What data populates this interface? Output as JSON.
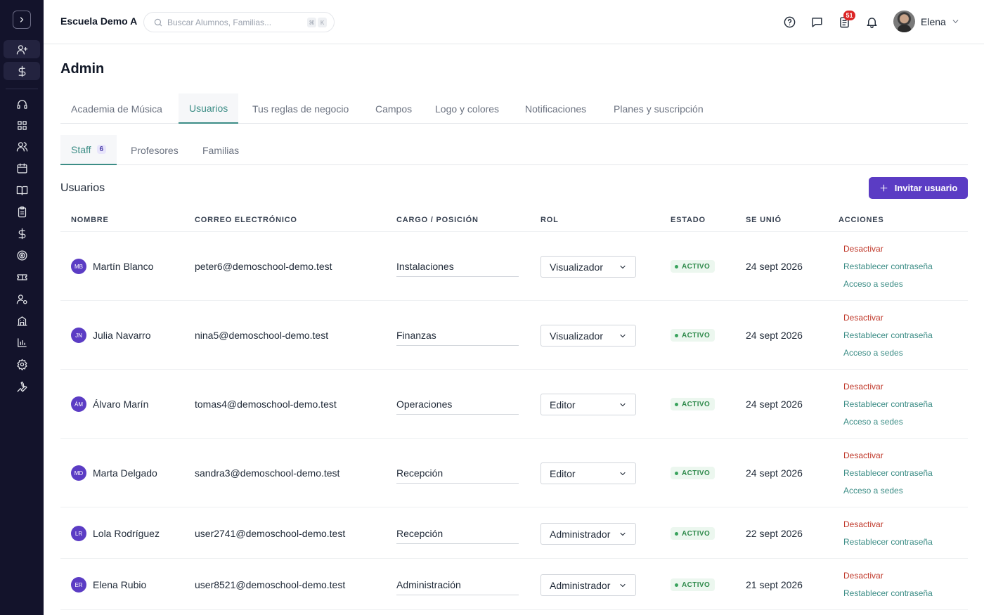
{
  "topbar": {
    "school_name": "Escuela Demo A",
    "search_placeholder": "Buscar Alumnos, Familias...",
    "kbd_1": "⌘",
    "kbd_2": "K",
    "notifications_count": "51",
    "user_name": "Elena"
  },
  "page": {
    "title": "Admin",
    "tabs": [
      "Academia de Música",
      "Usuarios",
      "Tus reglas de negocio",
      "Campos",
      "Logo y colores",
      "Notificaciones",
      "Planes y suscripción"
    ],
    "active_tab": "Usuarios",
    "subtabs": [
      "Staff",
      "Profesores",
      "Familias"
    ],
    "staff_count": "6",
    "section_title": "Usuarios",
    "invite_label": "Invitar usuario"
  },
  "table": {
    "headers": {
      "name": "NOMBRE",
      "email": "CORREO ELECTRÓNICO",
      "position": "CARGO / POSICIÓN",
      "role": "ROL",
      "status": "ESTADO",
      "joined": "SE UNIÓ",
      "actions": "ACCIONES"
    },
    "action_labels": {
      "deactivate": "Desactivar",
      "reset_password": "Restablecer contraseña",
      "site_access": "Acceso a sedes"
    },
    "rows": [
      {
        "initials": "MB",
        "name": "Martín Blanco",
        "email": "peter6@demoschool-demo.test",
        "position": "Instalaciones",
        "role": "Visualizador",
        "status": "ACTIVO",
        "joined": "24 sept 2026"
      },
      {
        "initials": "JN",
        "name": "Julia Navarro",
        "email": "nina5@demoschool-demo.test",
        "position": "Finanzas",
        "role": "Visualizador",
        "status": "ACTIVO",
        "joined": "24 sept 2026"
      },
      {
        "initials": "ÁM",
        "name": "Álvaro Marín",
        "email": "tomas4@demoschool-demo.test",
        "position": "Operaciones",
        "role": "Editor",
        "status": "ACTIVO",
        "joined": "24 sept 2026"
      },
      {
        "initials": "MD",
        "name": "Marta Delgado",
        "email": "sandra3@demoschool-demo.test",
        "position": "Recepción",
        "role": "Editor",
        "status": "ACTIVO",
        "joined": "24 sept 2026"
      },
      {
        "initials": "LR",
        "name": "Lola Rodríguez",
        "email": "user2741@demoschool-demo.test",
        "position": "Recepción",
        "role": "Administrador",
        "status": "ACTIVO",
        "joined": "22 sept 2026"
      },
      {
        "initials": "ER",
        "name": "Elena Rubio",
        "email": "user8521@demoschool-demo.test",
        "position": "Administración",
        "role": "Administrador",
        "status": "ACTIVO",
        "joined": "21 sept 2026"
      }
    ]
  },
  "colors": {
    "sidebar_bg": "#13132b",
    "accent_teal": "#3c8d86",
    "primary_purple": "#5b3cc4",
    "danger_red": "#c0392b",
    "status_green": "#2f8a4b"
  },
  "icons": [
    "chevron-right-icon",
    "user-plus-icon",
    "dollar-icon",
    "headset-icon",
    "grid-icon",
    "users-icon",
    "calendar-icon",
    "book-icon",
    "clipboard-icon",
    "dollar-icon",
    "target-icon",
    "ticket-icon",
    "user-settings-icon",
    "building-icon",
    "bar-chart-icon",
    "gear-icon",
    "wrench-icon",
    "search-icon",
    "help-icon",
    "message-icon",
    "task-icon",
    "bell-icon",
    "chevron-down-icon",
    "plus-icon"
  ]
}
